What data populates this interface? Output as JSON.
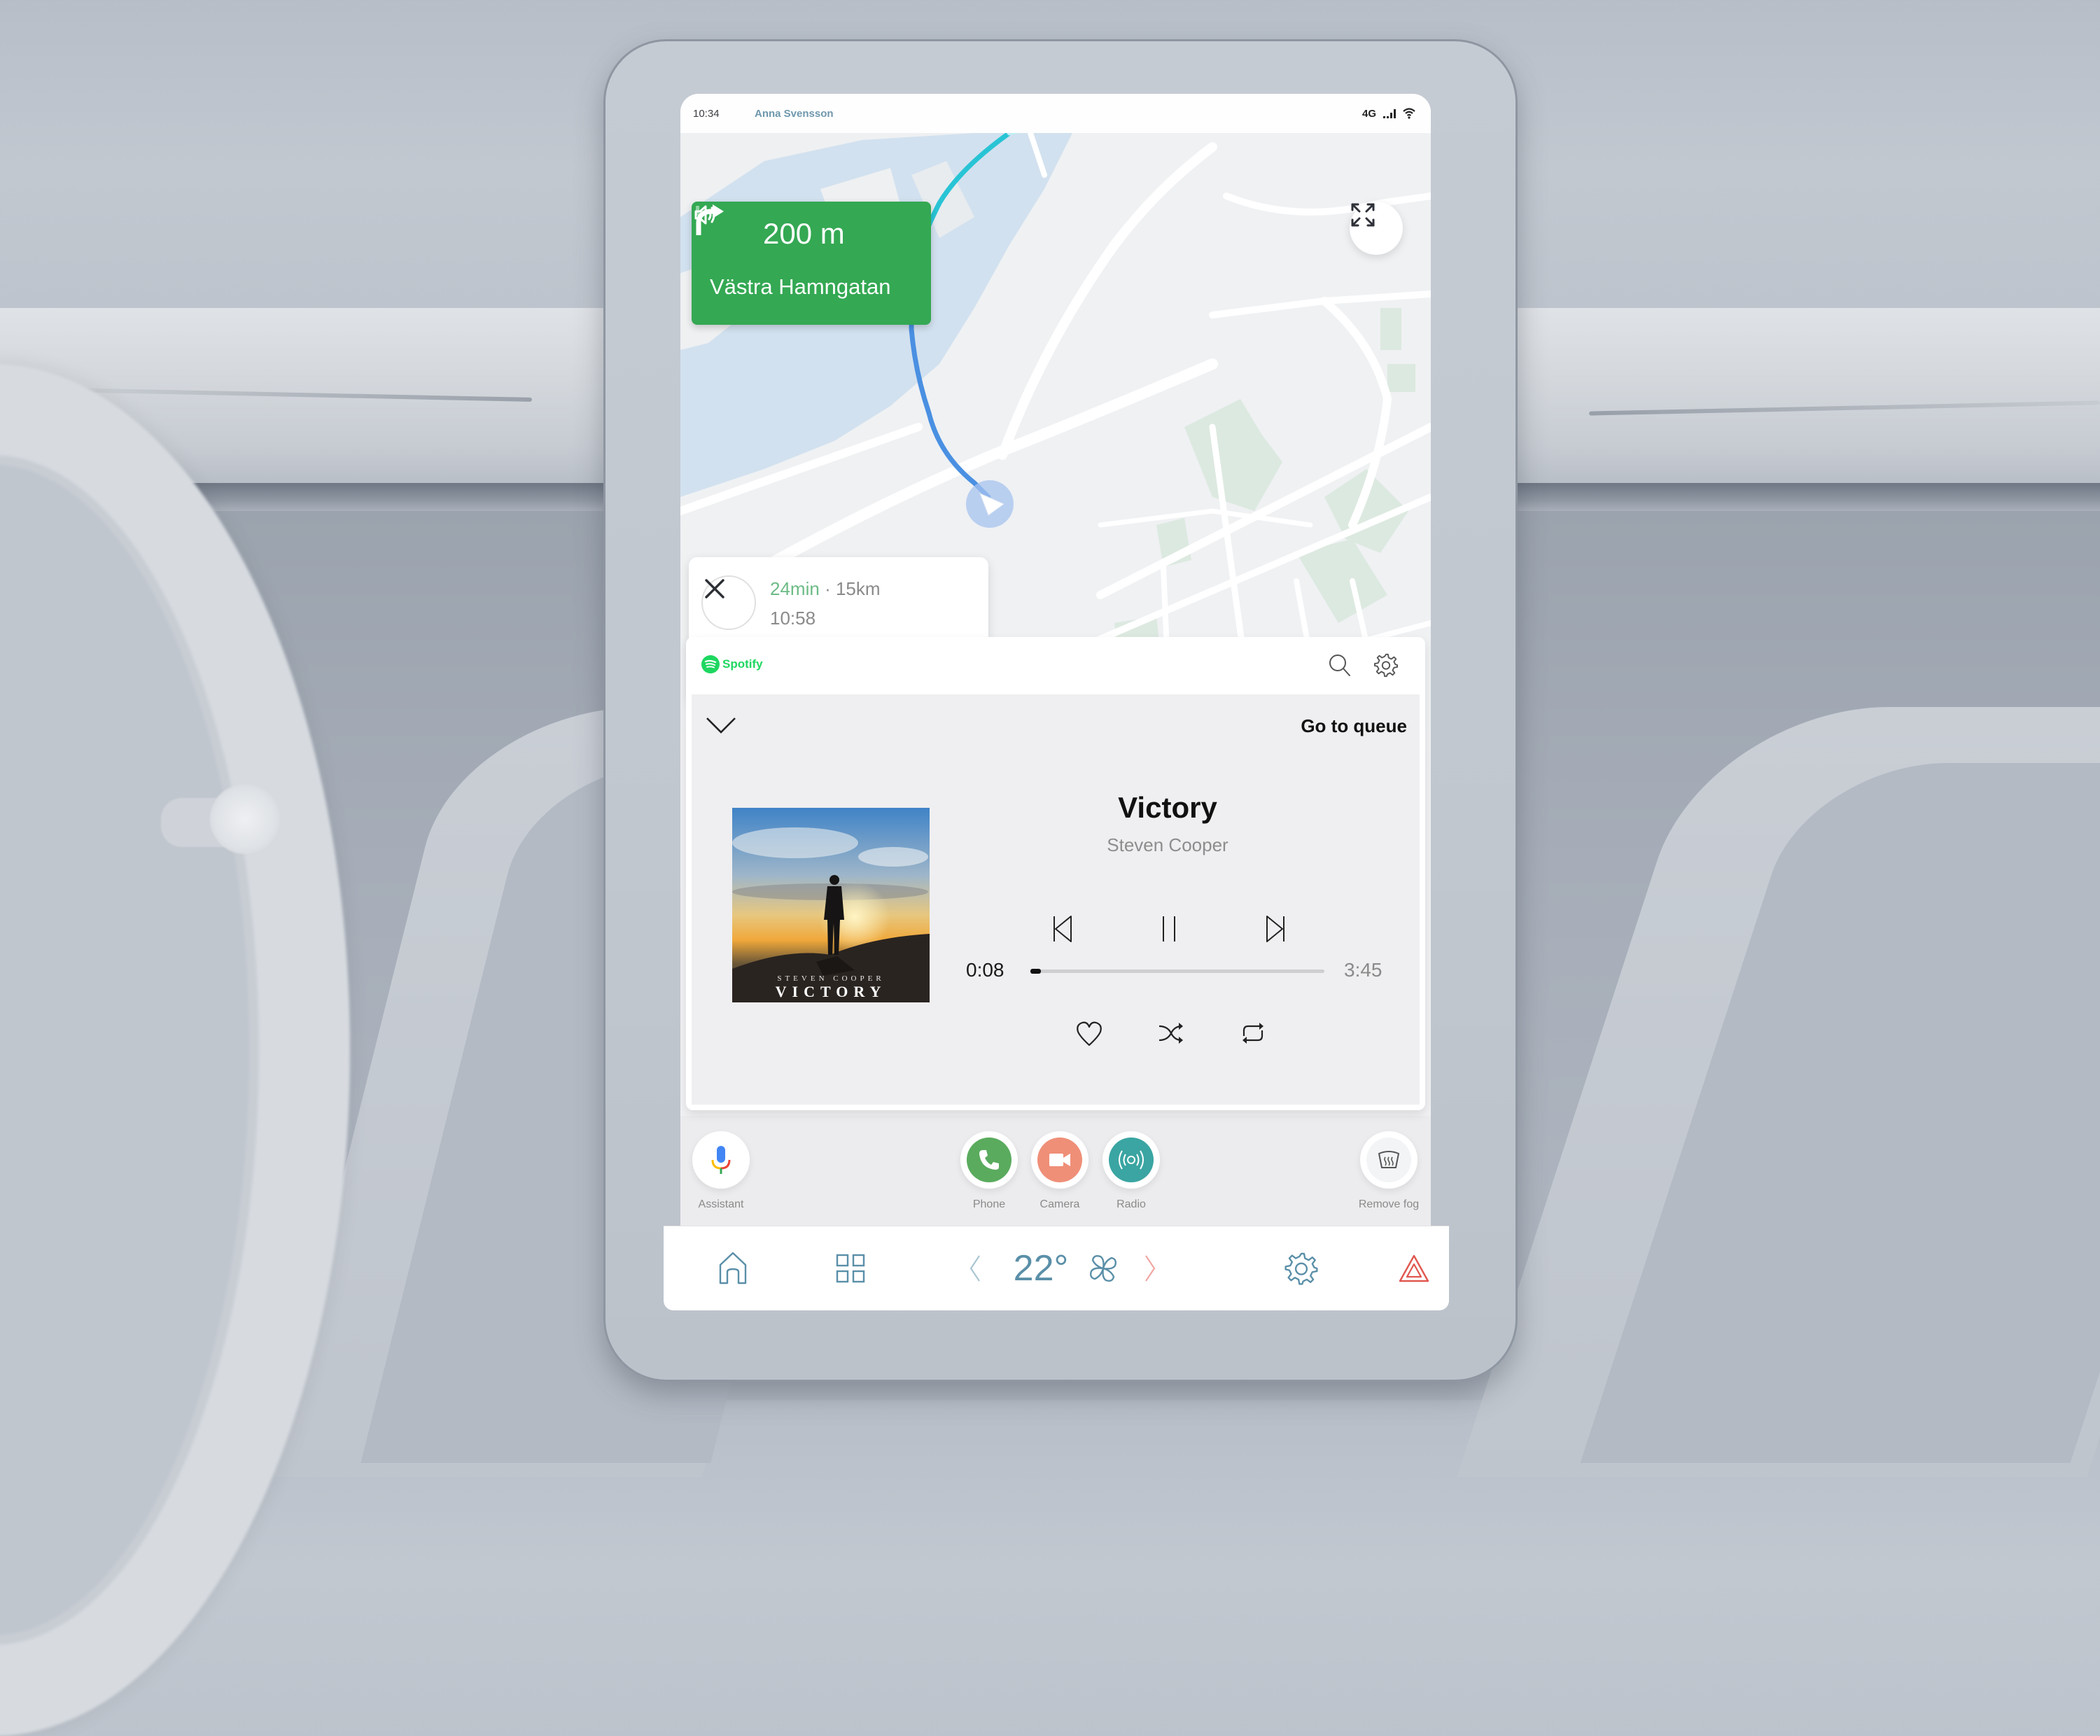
{
  "status_bar": {
    "time": "10:34",
    "user_name": "Anna Svensson",
    "network": "4G",
    "signal_icon": "signal-bars-icon",
    "wifi_icon": "wifi-icon"
  },
  "navigation": {
    "turn_icon": "turn-right-arrow-icon",
    "distance": "200 m",
    "street": "Västra Hamngatan",
    "sound_icon": "volume-icon",
    "card_color": "#34a853",
    "expand_icon": "expand-fullscreen-icon",
    "route_colors": {
      "ahead": "#1fc2d3",
      "near": "#4a90e2"
    }
  },
  "trip": {
    "duration": "24min",
    "separator": "·",
    "distance": "15km",
    "arrival_time": "10:58",
    "close_icon": "close-icon",
    "actions": [
      {
        "name": "settings",
        "icon": "gear-icon"
      },
      {
        "name": "alternate-routes",
        "icon": "route-fork-icon"
      },
      {
        "name": "search",
        "icon": "search-icon"
      },
      {
        "name": "places",
        "icon": "location-pin-icon"
      }
    ]
  },
  "spotify": {
    "app_name": "Spotify",
    "brand_color": "#1ed760",
    "search_icon": "search-icon",
    "settings_icon": "gear-icon",
    "collapse_icon": "chevron-down-icon",
    "go_to_queue": "Go to queue",
    "album": {
      "artist_caption": "STEVEN COOPER",
      "title_caption": "VICTORY"
    },
    "track": {
      "title": "Victory",
      "artist": "Steven Cooper"
    },
    "controls": {
      "previous_icon": "skip-previous-icon",
      "pause_icon": "pause-icon",
      "next_icon": "skip-next-icon",
      "like_icon": "heart-icon",
      "shuffle_icon": "shuffle-icon",
      "repeat_icon": "repeat-icon"
    },
    "playback": {
      "elapsed": "0:08",
      "total": "3:45",
      "progress_fraction": 0.036
    }
  },
  "quick_actions": [
    {
      "label": "Assistant",
      "icon": "microphone-icon",
      "color": "#ffffff"
    },
    {
      "label": "Phone",
      "icon": "phone-icon",
      "color": "#5aab5e"
    },
    {
      "label": "Camera",
      "icon": "video-camera-icon",
      "color": "#ef8f78"
    },
    {
      "label": "Radio",
      "icon": "radio-broadcast-icon",
      "color": "#3aa5a2"
    },
    {
      "label": "Remove fog",
      "icon": "defrost-icon",
      "color": "#f2f4f6"
    }
  ],
  "bottom_bar": {
    "home_icon": "home-icon",
    "apps_icon": "app-grid-icon",
    "temp_down_icon": "chevron-left-icon",
    "temperature": "22°",
    "fan_icon": "fan-icon",
    "temp_up_icon": "chevron-right-icon",
    "settings_icon": "gear-icon",
    "hazard_icon": "hazard-warning-icon",
    "accent_color": "#5a8fa8",
    "hazard_color": "#e0574f"
  }
}
